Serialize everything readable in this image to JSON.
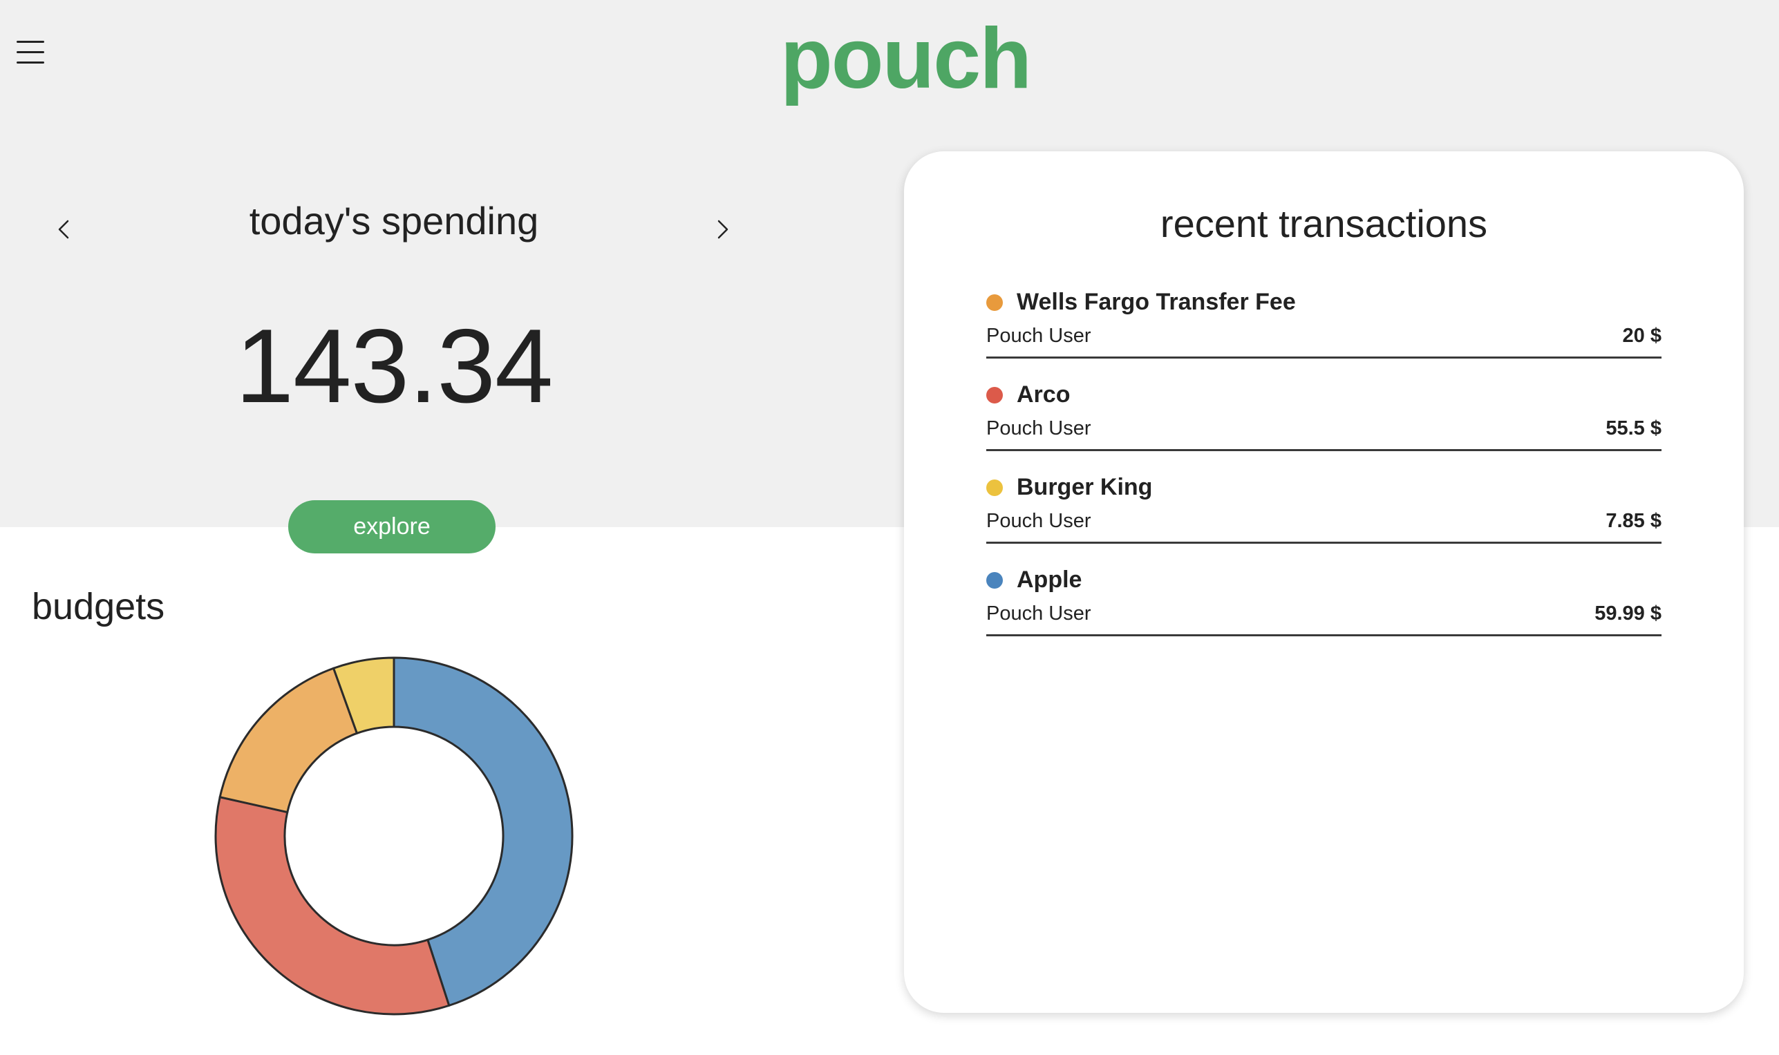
{
  "app": {
    "logo": "pouch"
  },
  "colors": {
    "brand": "#4ea664",
    "button": "#55ac6a",
    "text": "#222222",
    "band": "#f0f0f0",
    "orange": "#e89a3c",
    "red": "#dc5a4a",
    "yellow": "#ecc23e",
    "blue": "#4a84bd"
  },
  "header": {
    "menu_icon": "hamburger-menu-icon"
  },
  "spending": {
    "title": "today's spending",
    "amount": "143.34",
    "prev_icon": "chevron-left-icon",
    "next_icon": "chevron-right-icon",
    "explore_label": "explore"
  },
  "budgets": {
    "title": "budgets"
  },
  "chart_data": {
    "type": "pie",
    "hole": true,
    "slices": [
      {
        "value": 45.0,
        "color": "#6799c4"
      },
      {
        "value": 33.5,
        "color": "#e07868"
      },
      {
        "value": 16.0,
        "color": "#edb166"
      },
      {
        "value": 5.5,
        "color": "#efd068"
      }
    ]
  },
  "transactions": {
    "title": "recent transactions",
    "items": [
      {
        "name": "Wells Fargo Transfer Fee",
        "user": "Pouch User",
        "amount": "20 $",
        "color": "#e89a3c"
      },
      {
        "name": "Arco",
        "user": "Pouch User",
        "amount": "55.5 $",
        "color": "#dc5a4a"
      },
      {
        "name": "Burger King",
        "user": "Pouch User",
        "amount": "7.85 $",
        "color": "#ecc23e"
      },
      {
        "name": "Apple",
        "user": "Pouch User",
        "amount": "59.99 $",
        "color": "#4a84bd"
      }
    ]
  }
}
